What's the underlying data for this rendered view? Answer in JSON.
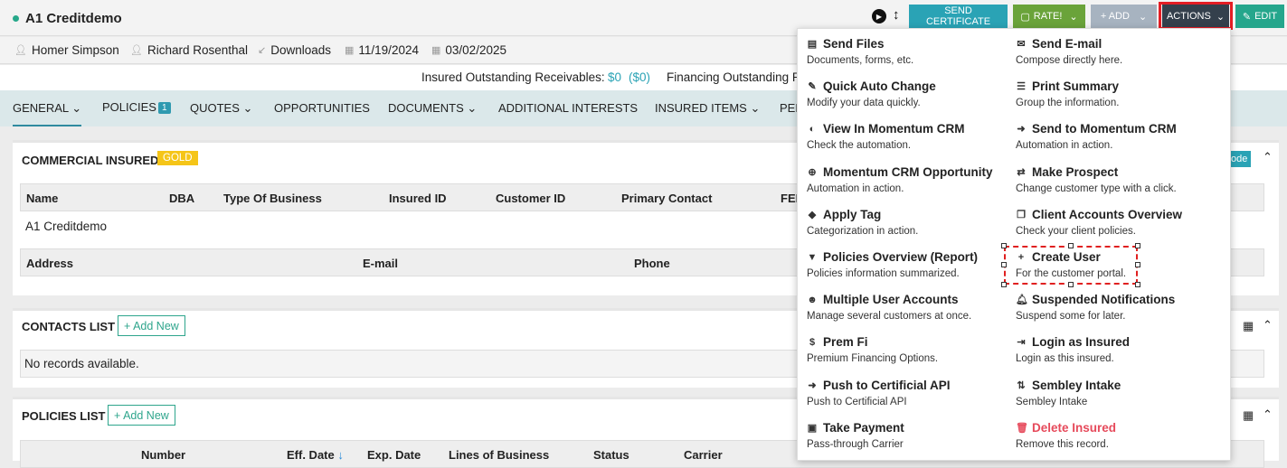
{
  "header": {
    "title": "A1 Creditdemo"
  },
  "toolbar": {
    "send_certificate": "SEND CERTIFICATE",
    "rate": "RATE!",
    "add": "+ ADD",
    "actions": "ACTIONS",
    "edit": "EDIT",
    "colors": {
      "teal": "#2aa3b5",
      "green": "#6aa33a",
      "gray": "#a7b3c0",
      "dark": "#34404c",
      "edit": "#25a68c"
    }
  },
  "info": {
    "user1": "Homer Simpson",
    "user2": "Richard Rosenthal",
    "source": "Downloads",
    "date1": "11/19/2024",
    "date2": "03/02/2025"
  },
  "receivables": {
    "insured_label": "Insured Outstanding Receivables:",
    "insured_val": "$0",
    "insured_paren": "($0)",
    "financing_label": "Financing Outstanding R"
  },
  "tabs": {
    "general": "GENERAL",
    "policies": "POLICIES",
    "policies_count": "1",
    "quotes": "QUOTES",
    "opportunities": "OPPORTUNITIES",
    "documents": "DOCUMENTS",
    "additional": "ADDITIONAL INTERESTS",
    "insured_items": "INSURED ITEMS",
    "pen": "PEN"
  },
  "commercial": {
    "title": "COMMERCIAL INSURED",
    "tier": "GOLD",
    "mode_fragment": "ode",
    "headers": [
      "Name",
      "DBA",
      "Type Of Business",
      "Insured ID",
      "Customer ID",
      "Primary Contact",
      "FEI"
    ],
    "name_value": "A1 Creditdemo",
    "headers2": [
      "Address",
      "E-mail",
      "Phone"
    ]
  },
  "contacts": {
    "title": "CONTACTS LIST",
    "add": "+ Add New",
    "empty": "No records available."
  },
  "policies": {
    "title": "POLICIES LIST",
    "add": "+ Add New",
    "headers": [
      "Number",
      "Eff. Date",
      "Exp. Date",
      "Lines of Business",
      "Status",
      "Carrier"
    ]
  },
  "menu": {
    "items": [
      {
        "title": "Send Files",
        "desc": "Documents, forms, etc.",
        "icon": "file-icon"
      },
      {
        "title": "Send E-mail",
        "desc": "Compose directly here.",
        "icon": "envelope-icon"
      },
      {
        "title": "Quick Auto Change",
        "desc": "Modify your data quickly.",
        "icon": "edit-icon"
      },
      {
        "title": "Print Summary",
        "desc": "Group the information.",
        "icon": "print-icon"
      },
      {
        "title": "View In Momentum CRM",
        "desc": "Check the automation.",
        "icon": "shield-icon"
      },
      {
        "title": "Send to Momentum CRM",
        "desc": "Automation in action.",
        "icon": "arrow-circle-icon"
      },
      {
        "title": "Momentum CRM Opportunity",
        "desc": "Automation in action.",
        "icon": "plus-circle-icon"
      },
      {
        "title": "Make Prospect",
        "desc": "Change customer type with a click.",
        "icon": "user-swap-icon"
      },
      {
        "title": "Apply Tag",
        "desc": "Categorization in action.",
        "icon": "tag-icon"
      },
      {
        "title": "Client Accounts Overview",
        "desc": "Check your client policies.",
        "icon": "copy-icon"
      },
      {
        "title": "Policies Overview (Report)",
        "desc": "Policies information summarized.",
        "icon": "filter-icon"
      },
      {
        "title": "Create User",
        "desc": "For the customer portal.",
        "icon": "user-plus-icon"
      },
      {
        "title": "Multiple User Accounts",
        "desc": "Manage several customers at once.",
        "icon": "users-icon"
      },
      {
        "title": "Suspended Notifications",
        "desc": "Suspend some for later.",
        "icon": "bell-icon"
      },
      {
        "title": "Prem Fi",
        "desc": "Premium Financing Options.",
        "icon": "dollar-icon"
      },
      {
        "title": "Login as Insured",
        "desc": "Login as this insured.",
        "icon": "login-icon"
      },
      {
        "title": "Push to Certificial API",
        "desc": "Push to Certificial API",
        "icon": "arrow-circle-icon"
      },
      {
        "title": "Sembley Intake",
        "desc": "Sembley Intake",
        "icon": "sort-icon"
      },
      {
        "title": "Take Payment",
        "desc": "Pass-through Carrier",
        "icon": "wallet-icon"
      },
      {
        "title": "Delete Insured",
        "desc": "Remove this record.",
        "icon": "trash-icon",
        "color": "#e64a5b"
      }
    ]
  }
}
